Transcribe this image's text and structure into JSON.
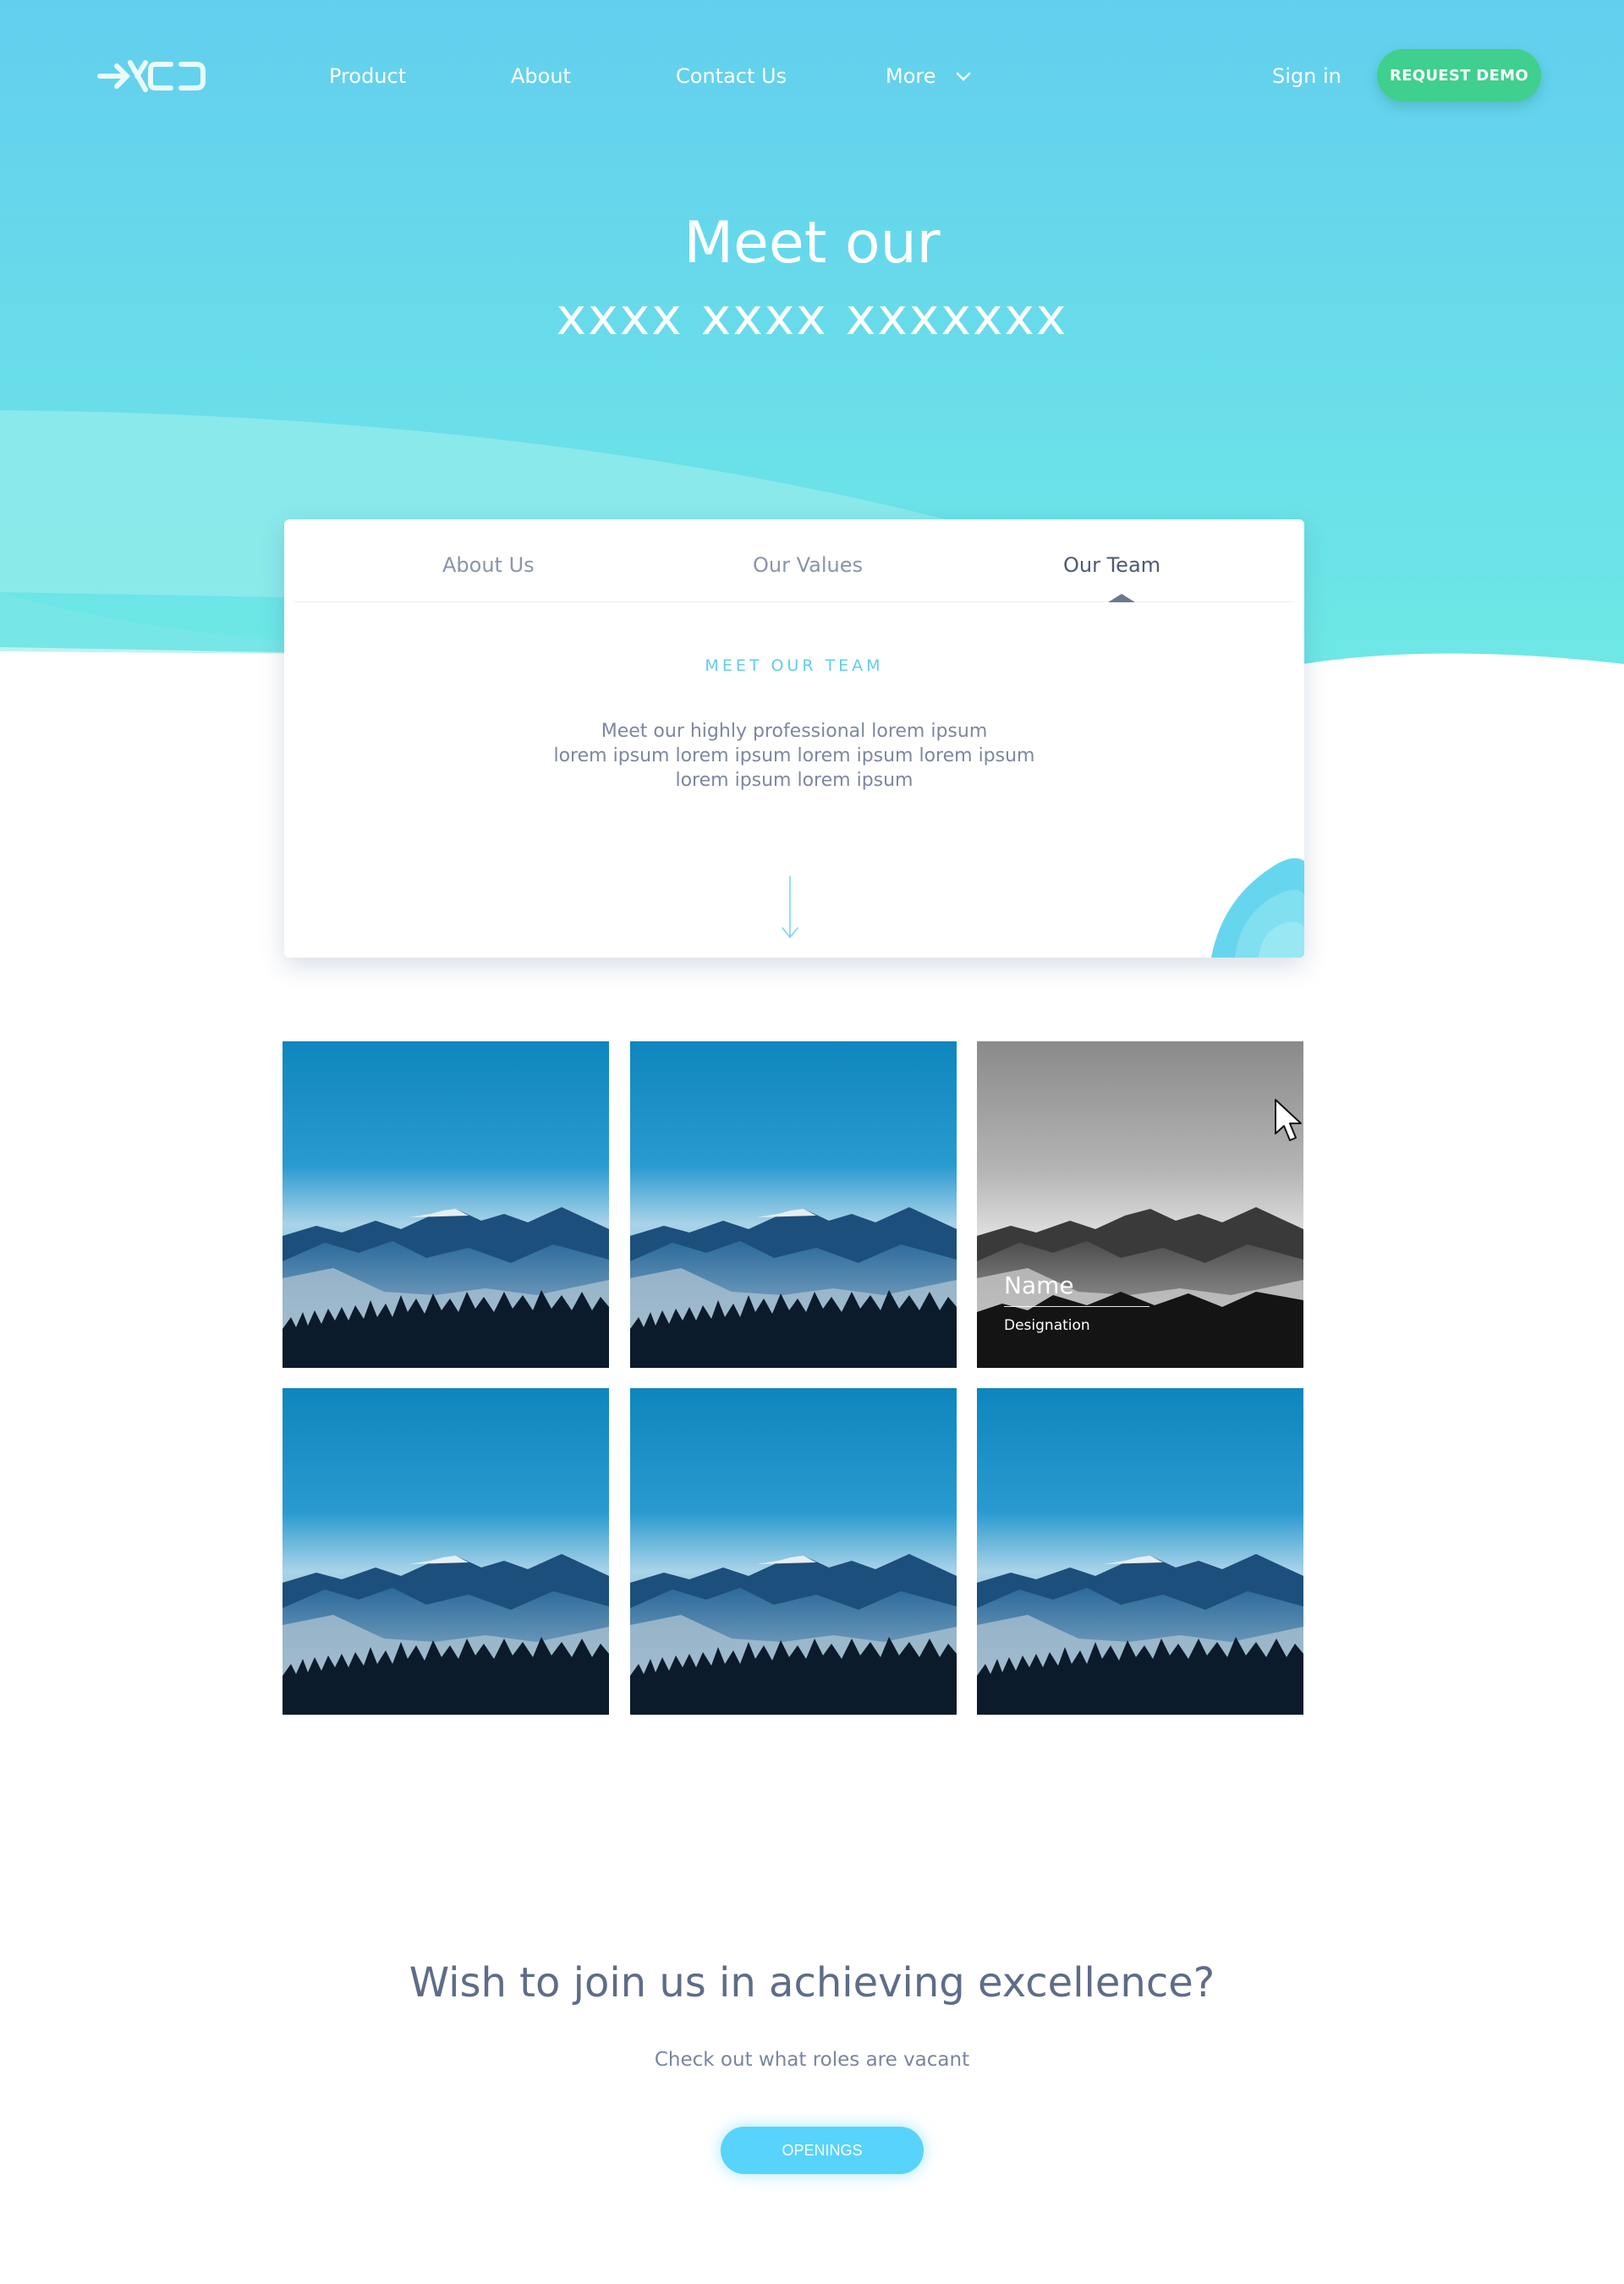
{
  "brand": {
    "logo_text": "XCD"
  },
  "nav": {
    "items": [
      {
        "label": "Product"
      },
      {
        "label": "About"
      },
      {
        "label": "Contact Us"
      },
      {
        "label": "More",
        "icon": "chevron-down-icon"
      }
    ],
    "signin_label": "Sign in",
    "demo_label": "REQUEST DEMO"
  },
  "hero": {
    "title_line1": "Meet our",
    "title_line2": "xxxx xxxx  xxxxxxx"
  },
  "card": {
    "tabs": [
      {
        "label": "About Us",
        "active": false
      },
      {
        "label": "Our Values",
        "active": false
      },
      {
        "label": "Our Team",
        "active": true
      }
    ],
    "eyebrow": "MEET OUR TEAM",
    "description_lines": [
      "Meet our highly professional lorem ipsum",
      "lorem ipsum lorem ipsum lorem ipsum lorem ipsum",
      "lorem ipsum lorem ipsum"
    ]
  },
  "team": {
    "hovered_tile": 3,
    "hover_card": {
      "name": "Name",
      "designation": "Designation"
    },
    "tiles": [
      {
        "image": "mountain-landscape"
      },
      {
        "image": "mountain-landscape"
      },
      {
        "image": "mountain-landscape"
      },
      {
        "image": "mountain-landscape"
      },
      {
        "image": "mountain-landscape"
      },
      {
        "image": "mountain-landscape"
      }
    ]
  },
  "cta": {
    "title": "Wish to join us in achieving excellence?",
    "subtitle": "Check out what roles are vacant",
    "button_label": "OPENINGS"
  },
  "colors": {
    "hero_top": "#62cfee",
    "hero_bottom": "#6ee6e6",
    "accent_green": "#3fcf8e",
    "accent_blue": "#58d3fb",
    "text": "#5f6b86"
  }
}
